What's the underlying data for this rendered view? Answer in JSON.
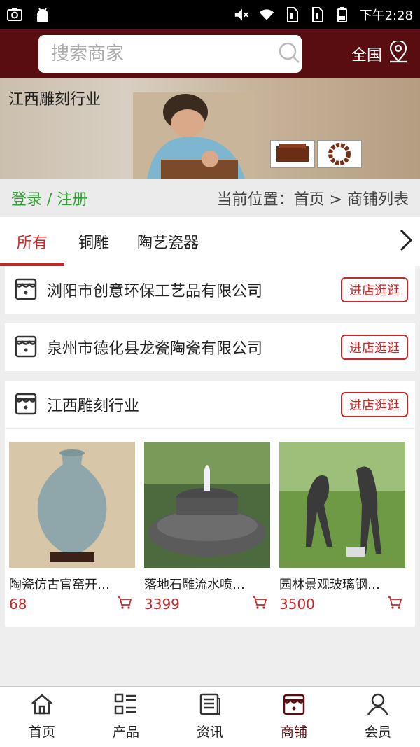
{
  "statusbar": {
    "time": "下午2:28"
  },
  "header": {
    "search_placeholder": "搜索商家",
    "region_label": "全国"
  },
  "banner": {
    "title": "江西雕刻行业"
  },
  "crumbs": {
    "login": "登录",
    "separator": " / ",
    "register": "注册",
    "position": "当前位置：首页 > 商铺列表"
  },
  "tabs": [
    {
      "label": "所有",
      "active": true
    },
    {
      "label": "铜雕",
      "active": false
    },
    {
      "label": "陶艺瓷器",
      "active": false
    }
  ],
  "visit_label": "进店逛逛",
  "shops": [
    {
      "name": "浏阳市创意环保工艺品有限公司"
    },
    {
      "name": "泉州市德化县龙瓷陶瓷有限公司"
    },
    {
      "name": "江西雕刻行业"
    }
  ],
  "products": [
    {
      "name": "陶瓷仿古官窑开…",
      "price": "68"
    },
    {
      "name": "落地石雕流水喷…",
      "price": "3399"
    },
    {
      "name": "园林景观玻璃钢…",
      "price": "3500"
    }
  ],
  "bottom_nav": [
    {
      "label": "首页",
      "icon": "home-icon"
    },
    {
      "label": "产品",
      "icon": "grid-list-icon"
    },
    {
      "label": "资讯",
      "icon": "news-icon"
    },
    {
      "label": "商铺",
      "icon": "shop-icon",
      "active": true
    },
    {
      "label": "会员",
      "icon": "user-icon"
    }
  ],
  "colors": {
    "brand": "#5a0d11",
    "accent": "#c62828",
    "login_green": "#33a033"
  }
}
